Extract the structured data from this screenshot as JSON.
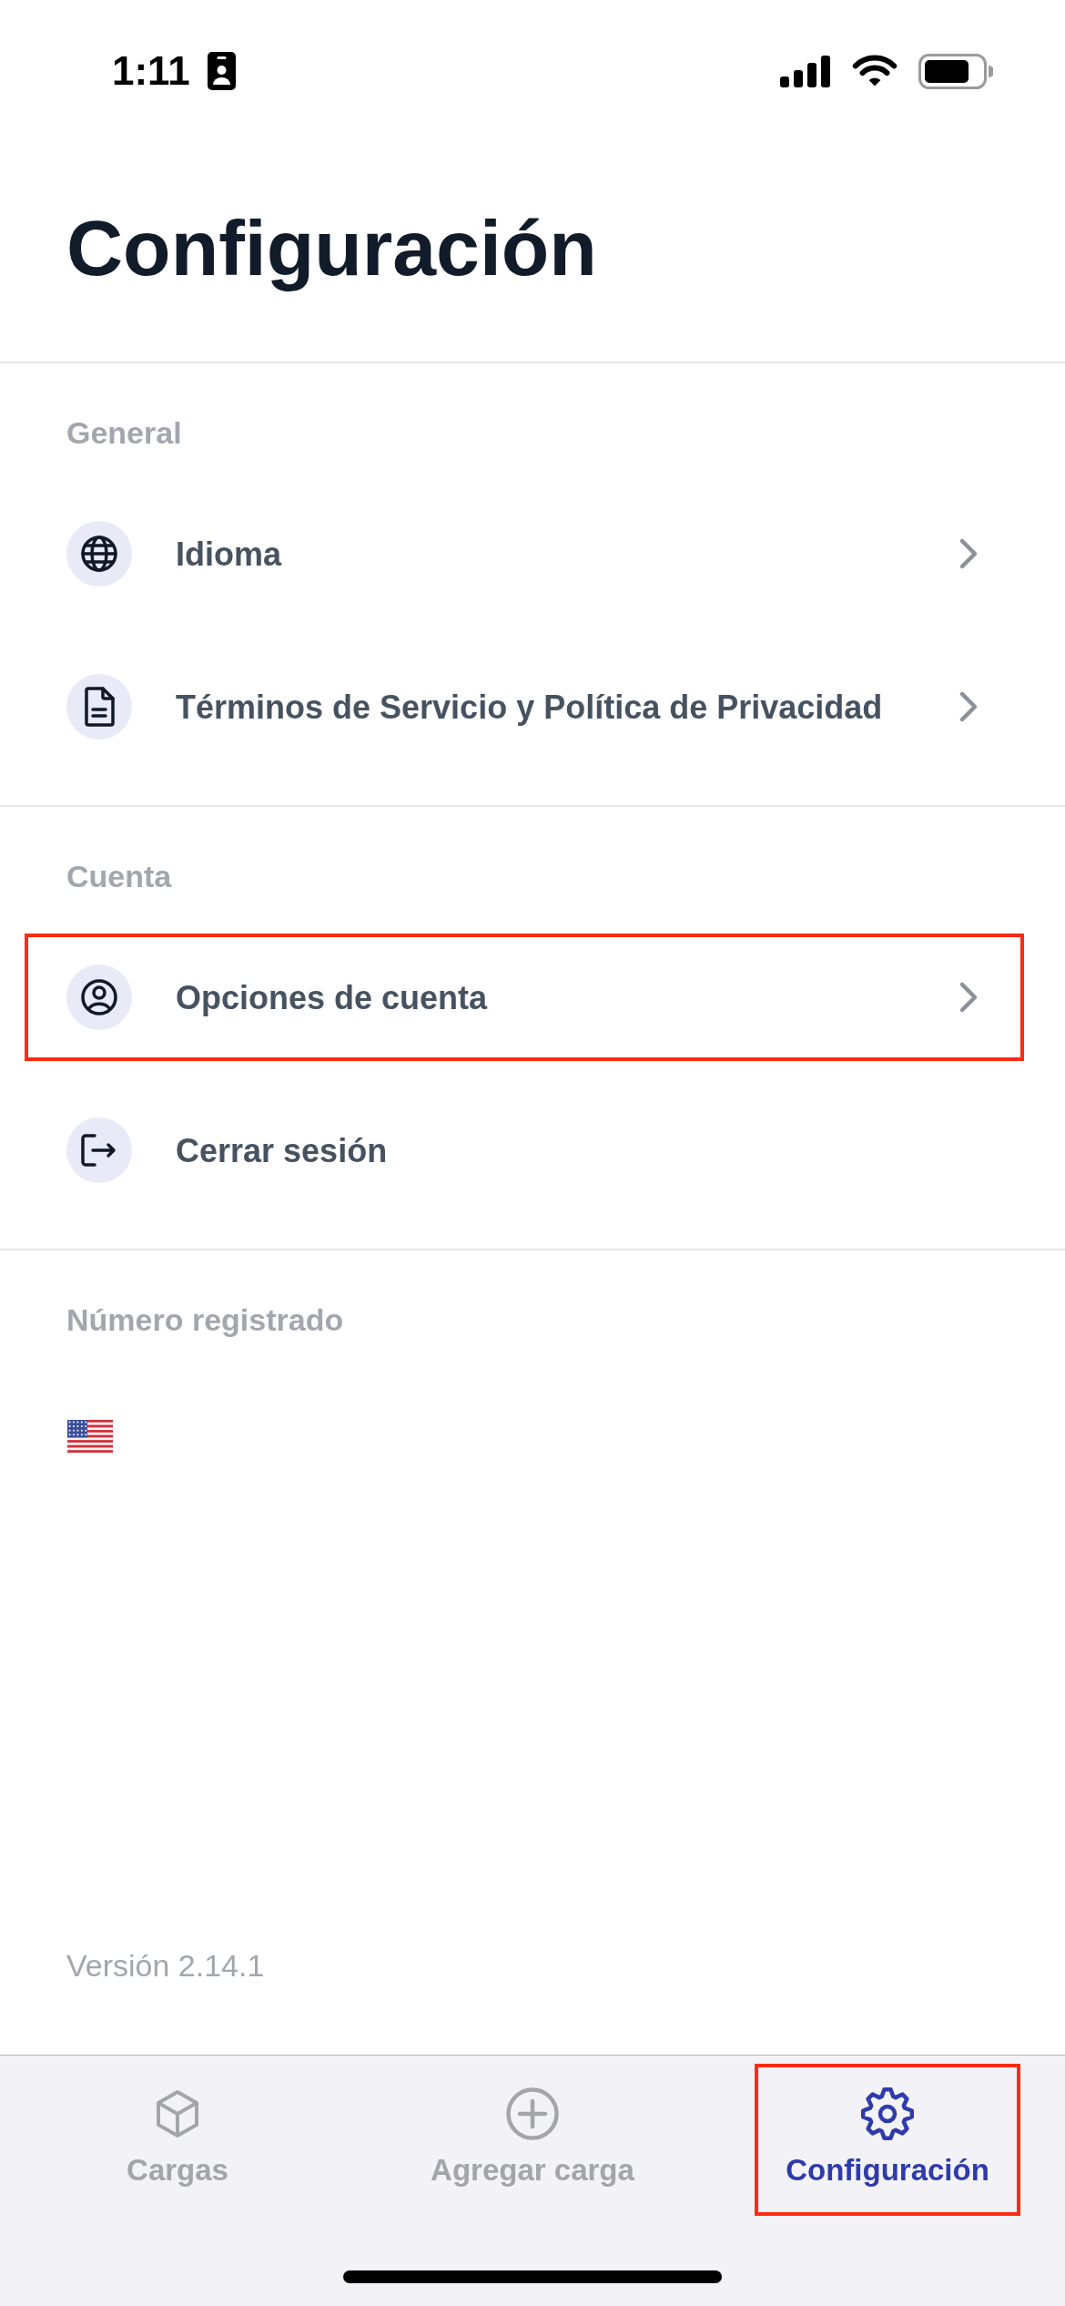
{
  "status_bar": {
    "time": "1:11"
  },
  "title": "Configuración",
  "sections": [
    {
      "header": "General",
      "items": [
        {
          "label": "Idioma",
          "kind": "link",
          "highlighted": false
        },
        {
          "label": "Términos de Servicio y Política de Privacidad",
          "kind": "link",
          "highlighted": false
        }
      ]
    },
    {
      "header": "Cuenta",
      "items": [
        {
          "label": "Opciones de cuenta",
          "kind": "link",
          "highlighted": true
        },
        {
          "label": "Cerrar sesión",
          "kind": "action",
          "highlighted": false
        }
      ]
    }
  ],
  "registered_number": {
    "header": "Número registrado"
  },
  "version": "Versión 2.14.1",
  "tab_bar": [
    {
      "label": "Cargas",
      "selected": false,
      "highlighted": false
    },
    {
      "label": "Agregar carga",
      "selected": false,
      "highlighted": false
    },
    {
      "label": "Configuración",
      "selected": true,
      "highlighted": true
    }
  ]
}
